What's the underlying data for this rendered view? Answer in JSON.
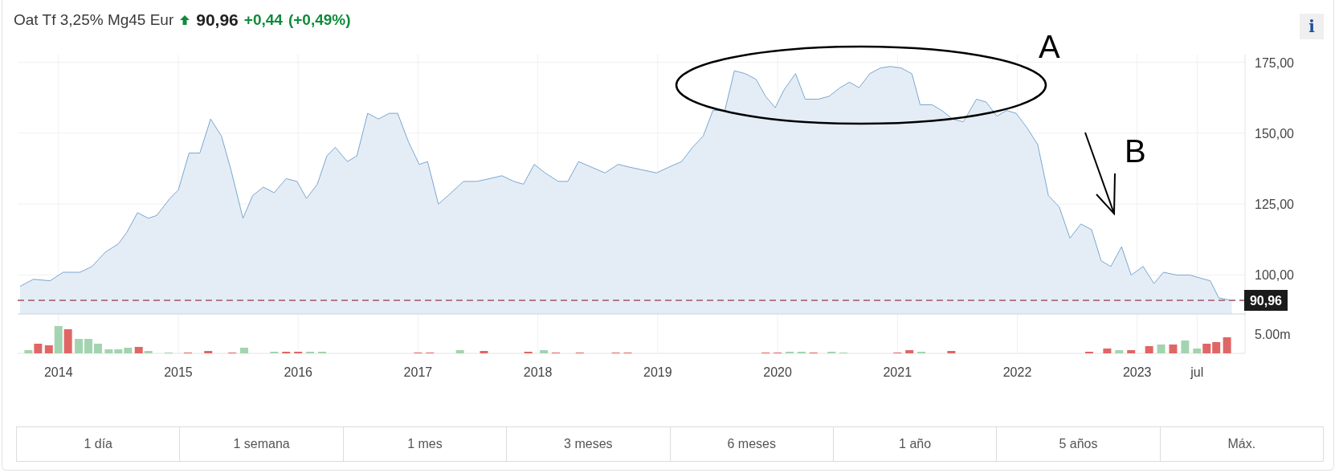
{
  "header": {
    "name": "Oat Tf 3,25% Mg45 Eur",
    "price": "90,96",
    "change": "+0,44",
    "change_percent": "(+0,49%)",
    "info_button": "i"
  },
  "chart_data": {
    "type": "area",
    "x": [
      2013.68,
      2013.79,
      2013.93,
      2014.04,
      2014.18,
      2014.28,
      2014.39,
      2014.5,
      2014.57,
      2014.66,
      2014.75,
      2014.82,
      2014.93,
      2015.0,
      2015.09,
      2015.18,
      2015.27,
      2015.36,
      2015.44,
      2015.54,
      2015.62,
      2015.71,
      2015.8,
      2015.9,
      2015.99,
      2016.07,
      2016.16,
      2016.24,
      2016.31,
      2016.41,
      2016.49,
      2016.58,
      2016.67,
      2016.76,
      2016.83,
      2016.92,
      2017.01,
      2017.08,
      2017.17,
      2017.25,
      2017.38,
      2017.49,
      2017.6,
      2017.7,
      2017.8,
      2017.88,
      2017.97,
      2018.06,
      2018.17,
      2018.25,
      2018.34,
      2018.45,
      2018.56,
      2018.67,
      2018.77,
      2018.88,
      2018.99,
      2019.09,
      2019.2,
      2019.29,
      2019.38,
      2019.46,
      2019.56,
      2019.64,
      2019.73,
      2019.82,
      2019.9,
      2019.98,
      2020.05,
      2020.15,
      2020.23,
      2020.34,
      2020.43,
      2020.52,
      2020.6,
      2020.68,
      2020.77,
      2020.86,
      2020.94,
      2021.03,
      2021.12,
      2021.19,
      2021.29,
      2021.37,
      2021.46,
      2021.55,
      2021.66,
      2021.74,
      2021.83,
      2021.91,
      2021.99,
      2022.08,
      2022.17,
      2022.26,
      2022.35,
      2022.44,
      2022.53,
      2022.62,
      2022.7,
      2022.78,
      2022.87,
      2022.95,
      2023.05,
      2023.14,
      2023.22,
      2023.33,
      2023.44,
      2023.52,
      2023.61,
      2023.68,
      2023.79
    ],
    "series": [
      {
        "color": "#7aa6cf",
        "values": [
          96,
          98.5,
          98,
          101,
          101,
          103,
          108,
          111,
          115,
          122,
          120,
          121,
          127,
          130,
          143,
          143,
          155,
          149,
          137,
          120,
          128,
          131,
          129,
          134,
          133,
          127,
          132,
          142,
          145,
          140,
          142,
          157,
          155,
          157,
          157,
          147,
          139,
          140,
          125,
          128,
          133,
          133,
          134,
          135,
          133,
          132,
          139,
          136,
          133,
          133,
          140,
          138,
          136,
          139,
          138,
          137,
          136,
          138,
          140,
          145,
          149,
          158,
          158,
          172,
          171,
          169,
          163,
          159,
          165,
          171,
          162,
          162,
          163,
          166,
          168,
          166,
          171,
          173,
          173.5,
          173,
          171,
          160,
          160,
          158,
          155,
          154,
          162,
          161,
          156,
          158,
          157,
          152,
          146,
          128,
          124,
          113,
          118,
          116,
          105,
          103,
          110,
          100,
          103,
          97,
          101,
          100,
          100,
          99,
          98,
          92,
          91
        ]
      }
    ],
    "xlim": [
      2013.66,
      2023.9
    ],
    "ylim": [
      72.4,
      177.7
    ],
    "grid": true,
    "xticks": [
      {
        "value": 2014,
        "label": "2014"
      },
      {
        "value": 2015,
        "label": "2015"
      },
      {
        "value": 2016,
        "label": "2016"
      },
      {
        "value": 2017,
        "label": "2017"
      },
      {
        "value": 2018,
        "label": "2018"
      },
      {
        "value": 2019,
        "label": "2019"
      },
      {
        "value": 2020,
        "label": "2020"
      },
      {
        "value": 2021,
        "label": "2021"
      },
      {
        "value": 2022,
        "label": "2022"
      },
      {
        "value": 2023,
        "label": "2023"
      },
      {
        "value": 2023.5,
        "label": "jul"
      }
    ],
    "yticks": [
      {
        "value": 100,
        "label": "100,00"
      },
      {
        "value": 125,
        "label": "125,00"
      },
      {
        "value": 150,
        "label": "150,00"
      },
      {
        "value": 175,
        "label": "175,00"
      }
    ],
    "annotations": [
      "A",
      "B"
    ]
  },
  "last_price_tag": "90,96",
  "volume_axis_label": "5.00m",
  "ranges": [
    {
      "label": "1 día",
      "selected": false
    },
    {
      "label": "1 semana",
      "selected": false
    },
    {
      "label": "1 mes",
      "selected": false
    },
    {
      "label": "3 meses",
      "selected": false
    },
    {
      "label": "6 meses",
      "selected": false
    },
    {
      "label": "1 año",
      "selected": false
    },
    {
      "label": "5 años",
      "selected": false
    },
    {
      "label": "Máx.",
      "selected": false
    }
  ]
}
